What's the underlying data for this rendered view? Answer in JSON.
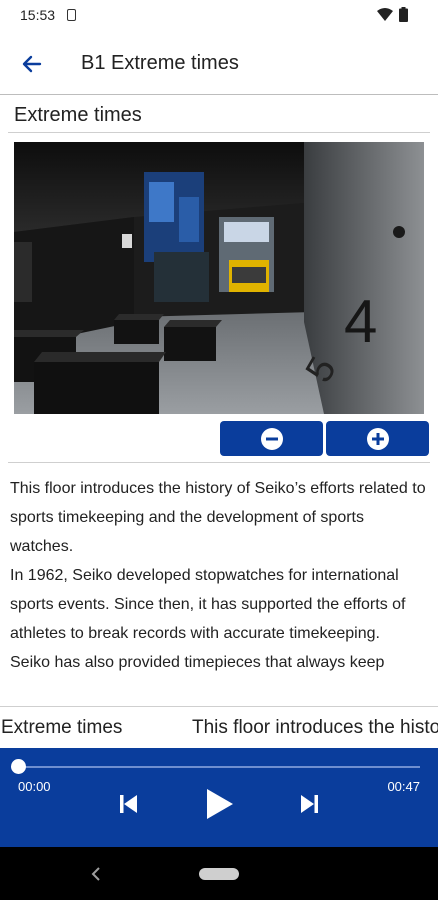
{
  "status_bar": {
    "time": "15:53"
  },
  "app_bar": {
    "title": "B1 Extreme times",
    "back_icon": "arrow-left-icon"
  },
  "section": {
    "title": "Extreme times",
    "image_alt_icon": "exhibition-room-photo"
  },
  "zoom": {
    "out_icon": "minus-circle-icon",
    "in_icon": "plus-circle-icon"
  },
  "description": {
    "paragraphs": [
      "This floor introduces the history of Seiko’s efforts related to sports timekeeping and the development of sports watches.",
      "In 1962, Seiko developed stopwatches for international sports events. Since then, it has supported the efforts of athletes to break records with accurate timekeeping.",
      "Seiko has also provided timepieces that always keep"
    ]
  },
  "now_playing": {
    "title": "Extreme times",
    "scroll_text": "This floor introduces the history of Seiko’s efforts related to sports timekeeping"
  },
  "player": {
    "current_time": "00:00",
    "duration": "00:47",
    "progress": 0,
    "accent_color": "#0a3d9c"
  }
}
